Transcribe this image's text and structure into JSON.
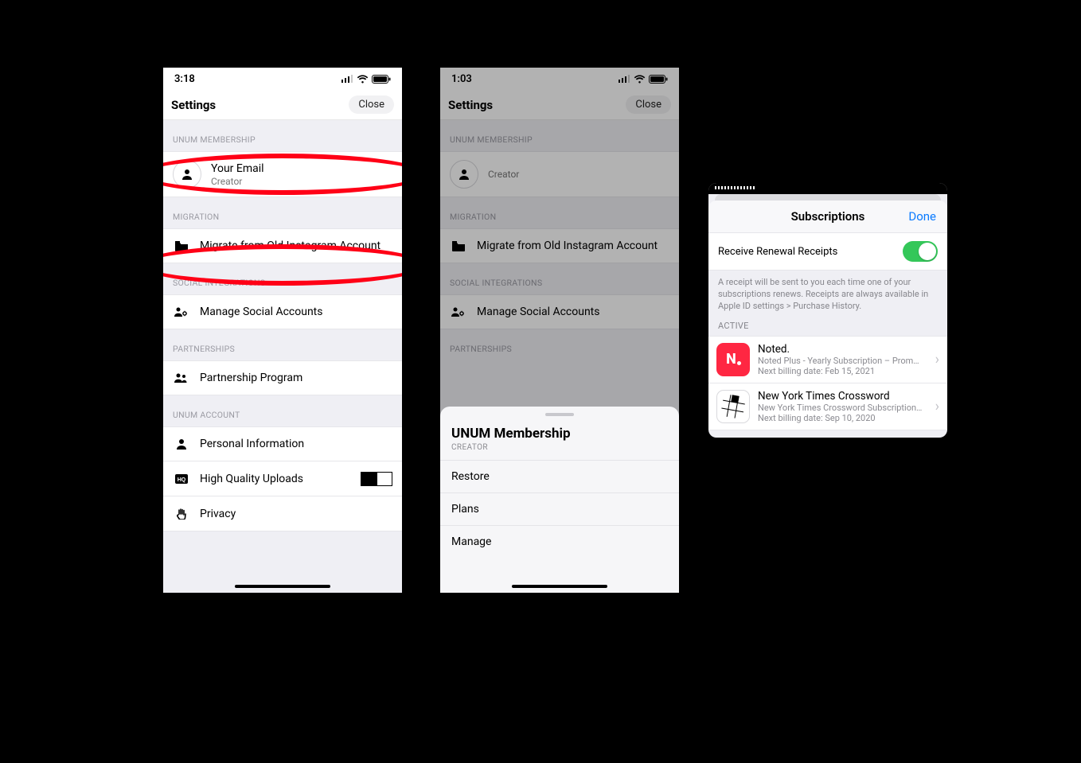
{
  "phone1": {
    "time": "3:18",
    "settings_title": "Settings",
    "close": "Close",
    "sections": {
      "membership_header": "UNUM MEMBERSHIP",
      "email_primary": "Your Email",
      "email_secondary": "Creator",
      "migration_header": "MIGRATION",
      "migrate_label": "Migrate from Old Instagram Account",
      "social_header": "SOCIAL INTEGRATIONS",
      "social_label": "Manage Social Accounts",
      "partnerships_header": "PARTNERSHIPS",
      "partnership_label": "Partnership Program",
      "account_header": "UNUM ACCOUNT",
      "personal_label": "Personal Information",
      "hq_label": "High Quality Uploads",
      "privacy_label": "Privacy"
    }
  },
  "phone2": {
    "time": "1:03",
    "settings_title": "Settings",
    "close": "Close",
    "sections": {
      "membership_header": "UNUM MEMBERSHIP",
      "email_secondary": "Creator",
      "migration_header": "MIGRATION",
      "migrate_label": "Migrate from Old Instagram Account",
      "social_header": "SOCIAL INTEGRATIONS",
      "social_label": "Manage Social Accounts",
      "partnerships_header": "PARTNERSHIPS"
    },
    "sheet": {
      "title": "UNUM Membership",
      "subtitle": "CREATOR",
      "items": [
        "Restore",
        "Plans",
        "Manage"
      ]
    }
  },
  "card3": {
    "title": "Subscriptions",
    "done": "Done",
    "receipts_label": "Receive Renewal Receipts",
    "receipts_on": true,
    "note": "A receipt will be sent to you each time one of your subscriptions renews. Receipts are always available in Apple ID settings > Purchase History.",
    "active_header": "ACTIVE",
    "items": [
      {
        "name": "Noted.",
        "desc": "Noted Plus - Yearly Subscription – Prom…",
        "next": "Next billing date: Feb 15, 2021"
      },
      {
        "name": "New York Times Crossword",
        "desc": "New York Times Crossword Subscription…",
        "next": "Next billing date: Sep 10, 2020"
      }
    ]
  }
}
